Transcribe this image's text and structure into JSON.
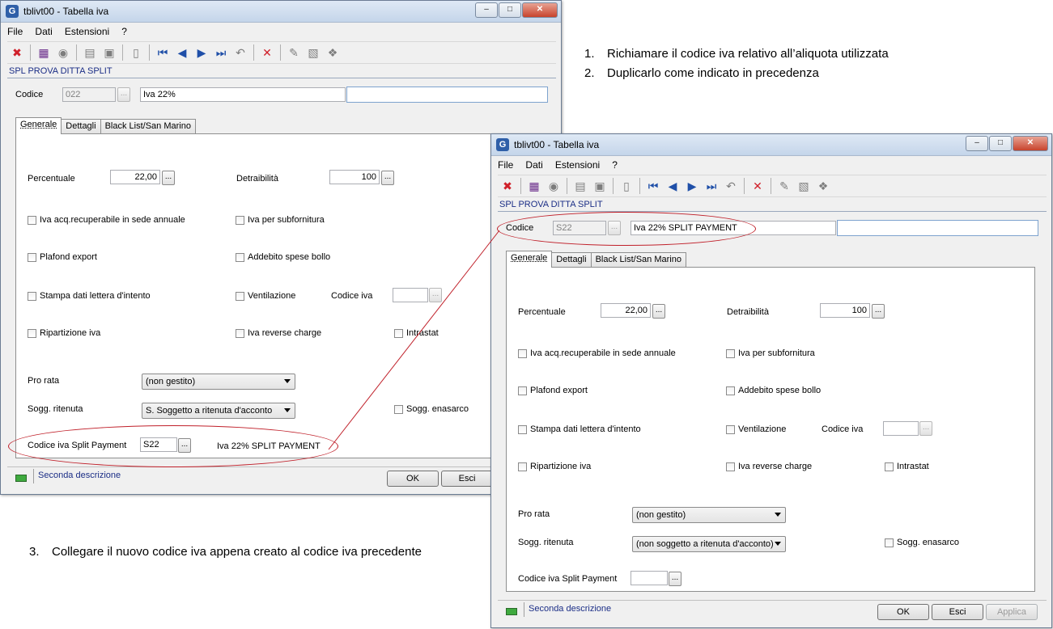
{
  "colors": {
    "accent": "#1b2e86",
    "annotation": "#c0202a",
    "status_led": "#3faa3f"
  },
  "window_common": {
    "menu": [
      "File",
      "Dati",
      "Estensioni",
      "?"
    ],
    "toolbar_icons": [
      "exit-icon",
      "book-icon",
      "binoculars-icon",
      "clipboard-icon",
      "paste-icon",
      "page-icon",
      "first-record-icon",
      "prev-record-icon",
      "next-record-icon",
      "last-record-icon",
      "undo-icon",
      "delete-icon",
      "edit-icon",
      "folder-icon",
      "tree-icon"
    ]
  },
  "window1": {
    "title": "tblivt00 - Tabella iva",
    "company": "SPL PROVA DITTA SPLIT",
    "codice_label": "Codice",
    "codice_value": "022",
    "codice_desc": "Iva 22%",
    "tabs": [
      "Generale",
      "Dettagli",
      "Black List/San Marino"
    ],
    "percentuale_label": "Percentuale",
    "percentuale_value": "22,00",
    "detraibilita_label": "Detraibilità",
    "detraibilita_value": "100",
    "checks": {
      "iva_acq": "Iva acq.recuperabile in sede annuale",
      "iva_sub": "Iva per subfornitura",
      "plafond": "Plafond export",
      "addebito": "Addebito spese bollo",
      "stampa": "Stampa dati lettera d'intento",
      "ventilazione": "Ventilazione",
      "ripartizione": "Ripartizione iva",
      "reverse": "Iva reverse charge",
      "intrastat": "Intrastat",
      "enasarco": "Sogg. enasarco"
    },
    "codice_iva_label": "Codice iva",
    "pro_rata_label": "Pro rata",
    "pro_rata_value": "(non gestito)",
    "sogg_rit_label": "Sogg. ritenuta",
    "sogg_rit_value": "S. Soggetto a ritenuta d'acconto",
    "split_label": "Codice iva Split Payment",
    "split_value": "S22",
    "split_desc": "Iva 22% SPLIT PAYMENT",
    "status_text": "Seconda descrizione",
    "ok": "OK",
    "esci": "Esci"
  },
  "window2": {
    "title": "tblivt00 - Tabella iva",
    "company": "SPL PROVA DITTA SPLIT",
    "codice_label": "Codice",
    "codice_value": "S22",
    "codice_desc": "Iva 22% SPLIT PAYMENT",
    "tabs": [
      "Generale",
      "Dettagli",
      "Black List/San Marino"
    ],
    "percentuale_label": "Percentuale",
    "percentuale_value": "22,00",
    "detraibilita_label": "Detraibilità",
    "detraibilita_value": "100",
    "checks": {
      "iva_acq": "Iva acq.recuperabile in sede annuale",
      "iva_sub": "Iva per subfornitura",
      "plafond": "Plafond export",
      "addebito": "Addebito spese bollo",
      "stampa": "Stampa dati lettera d'intento",
      "ventilazione": "Ventilazione",
      "ripartizione": "Ripartizione iva",
      "reverse": "Iva reverse charge",
      "intrastat": "Intrastat",
      "enasarco": "Sogg. enasarco"
    },
    "codice_iva_label": "Codice iva",
    "pro_rata_label": "Pro rata",
    "pro_rata_value": "(non gestito)",
    "sogg_rit_label": "Sogg. ritenuta",
    "sogg_rit_value": "(non soggetto a ritenuta d'acconto)",
    "split_label": "Codice iva Split Payment",
    "split_value": "",
    "status_text": "Seconda descrizione",
    "ok": "OK",
    "esci": "Esci",
    "applica": "Applica"
  },
  "notes": {
    "step1_num": "1.",
    "step1": "Richiamare il codice iva relativo all’aliquota utilizzata",
    "step2_num": "2.",
    "step2": "Duplicarlo come indicato in precedenza",
    "step3_num": "3.",
    "step3": "Collegare il nuovo codice iva appena creato al codice iva precedente"
  }
}
